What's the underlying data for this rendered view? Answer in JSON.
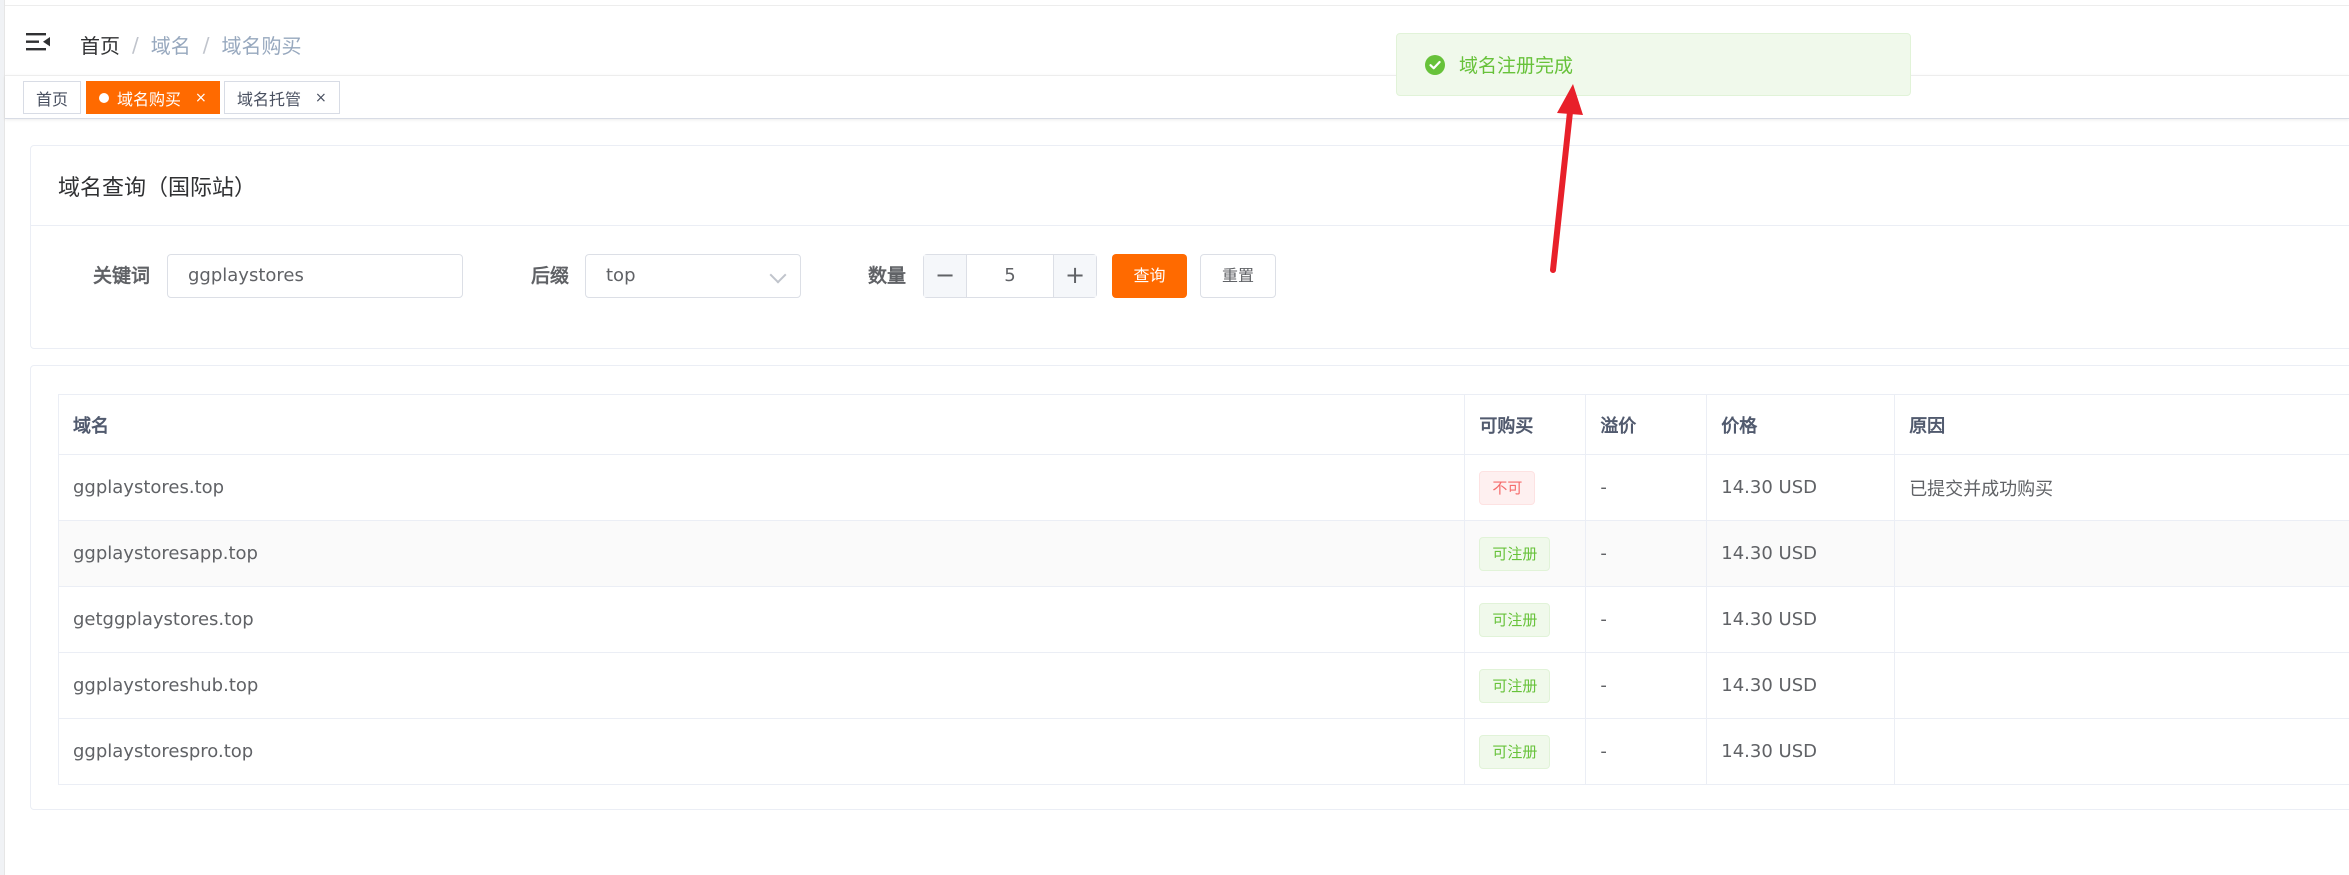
{
  "header": {
    "breadcrumb": [
      "首页",
      "域名",
      "域名购买"
    ]
  },
  "tags": [
    {
      "label": "首页",
      "close": ""
    },
    {
      "label": "域名购买",
      "close": "×"
    },
    {
      "label": "域名托管",
      "close": "×"
    }
  ],
  "search": {
    "title": "域名查询（国际站）",
    "keyword_label": "关键词",
    "keyword_value": "ggplaystores",
    "suffix_label": "后缀",
    "suffix_value": "top",
    "quantity_label": "数量",
    "quantity_value": "5",
    "minus": "−",
    "plus": "+",
    "query_button": "查询",
    "reset_button": "重置"
  },
  "table": {
    "headers": [
      "域名",
      "可购买",
      "溢价",
      "价格",
      "原因"
    ],
    "rows": [
      {
        "domain": "ggplaystores.top",
        "status": "不可",
        "premium": "-",
        "price": "14.30 USD",
        "reason": "已提交并成功购买"
      },
      {
        "domain": "ggplaystoresapp.top",
        "status": "可注册",
        "premium": "-",
        "price": "14.30 USD",
        "reason": ""
      },
      {
        "domain": "getggplaystores.top",
        "status": "可注册",
        "premium": "-",
        "price": "14.30 USD",
        "reason": ""
      },
      {
        "domain": "ggplaystoreshub.top",
        "status": "可注册",
        "premium": "-",
        "price": "14.30 USD",
        "reason": ""
      },
      {
        "domain": "ggplaystorespro.top",
        "status": "可注册",
        "premium": "-",
        "price": "14.30 USD",
        "reason": ""
      }
    ]
  },
  "toast": {
    "message": "域名注册完成",
    "icon": "check-circle-icon"
  },
  "colors": {
    "accent": "#ff6a00",
    "success": "#67c23a",
    "danger": "#f56c6c",
    "annotation_arrow": "#e8202a"
  }
}
